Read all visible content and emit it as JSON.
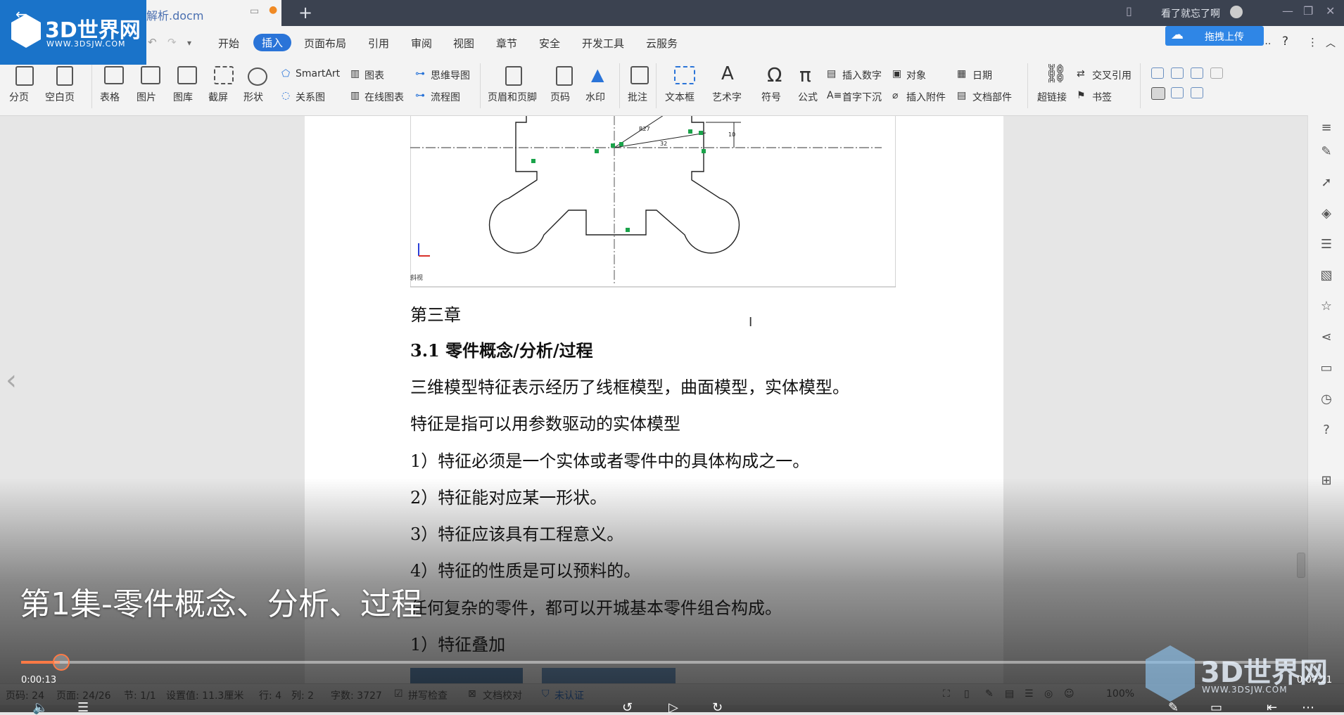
{
  "window": {
    "tab_title": "解析.docm",
    "user": "看了就忘了啊",
    "upload_button": "拖拽上传"
  },
  "menu": [
    "开始",
    "插入",
    "页面布局",
    "引用",
    "审阅",
    "视图",
    "章节",
    "安全",
    "开发工具",
    "云服务"
  ],
  "active_menu": "插入",
  "toolbar": {
    "fenye": "分页",
    "kongbaiye": "空白页",
    "biaoge": "表格",
    "tupian": "图片",
    "tuku": "图库",
    "jieping": "截屏",
    "xingzhuang": "形状",
    "smartart": "SmartArt",
    "guanxitu": "关系图",
    "tubiao": "图表",
    "zaixiantubiao": "在线图表",
    "siweidaotu": "思维导图",
    "liuchengtu": "流程图",
    "yemeiyejiao": "页眉和页脚",
    "yema": "页码",
    "shuiyin": "水印",
    "pizhu": "批注",
    "wenbenkuang": "文本框",
    "yishuzi": "艺术字",
    "fuhao": "符号",
    "gongshi": "公式",
    "charushuzi": "插入数字",
    "shouzixiachen": "首字下沉",
    "duixiang": "对象",
    "charufujian": "插入附件",
    "riqi": "日期",
    "wendangbujian": "文档部件",
    "chaolianjie": "超链接",
    "jiaochayinyong": "交叉引用",
    "shuqian": "书签"
  },
  "document": {
    "drawing_label": "斜视",
    "dim_a": "10",
    "dim_b": "32",
    "dim_c": "R27",
    "lines": [
      "第三章",
      "3.1 零件概念/分析/过程",
      "三维模型特征表示经历了线框模型，曲面模型，实体模型。",
      "特征是指可以用参数驱动的实体模型",
      "1）特征必须是一个实体或者零件中的具体构成之一。",
      "2）特征能对应某一形状。",
      "3）特征应该具有工程意义。",
      "4）特征的性质是可以预料的。",
      "任何复杂的零件，都可以开城基本零件组合构成。",
      "1）特征叠加"
    ]
  },
  "statusbar": {
    "page_num": "页码: 24",
    "pages": "页面: 24/26",
    "section": "节: 1/1",
    "setting": "设置值: 11.3厘米",
    "row": "行: 4",
    "col": "列: 2",
    "words": "字数: 3727",
    "spellcheck": "拼写检查",
    "doc_check": "文档校对",
    "cert": "未认证",
    "zoom": "100%"
  },
  "video": {
    "subtitle": "第1集-零件概念、分析、过程",
    "current_time": "0:00:13",
    "total_time": "0:07:21",
    "progress": 0.03
  },
  "watermark": {
    "brand": "3D世界网",
    "url": "WWW.3DSJW.COM"
  }
}
